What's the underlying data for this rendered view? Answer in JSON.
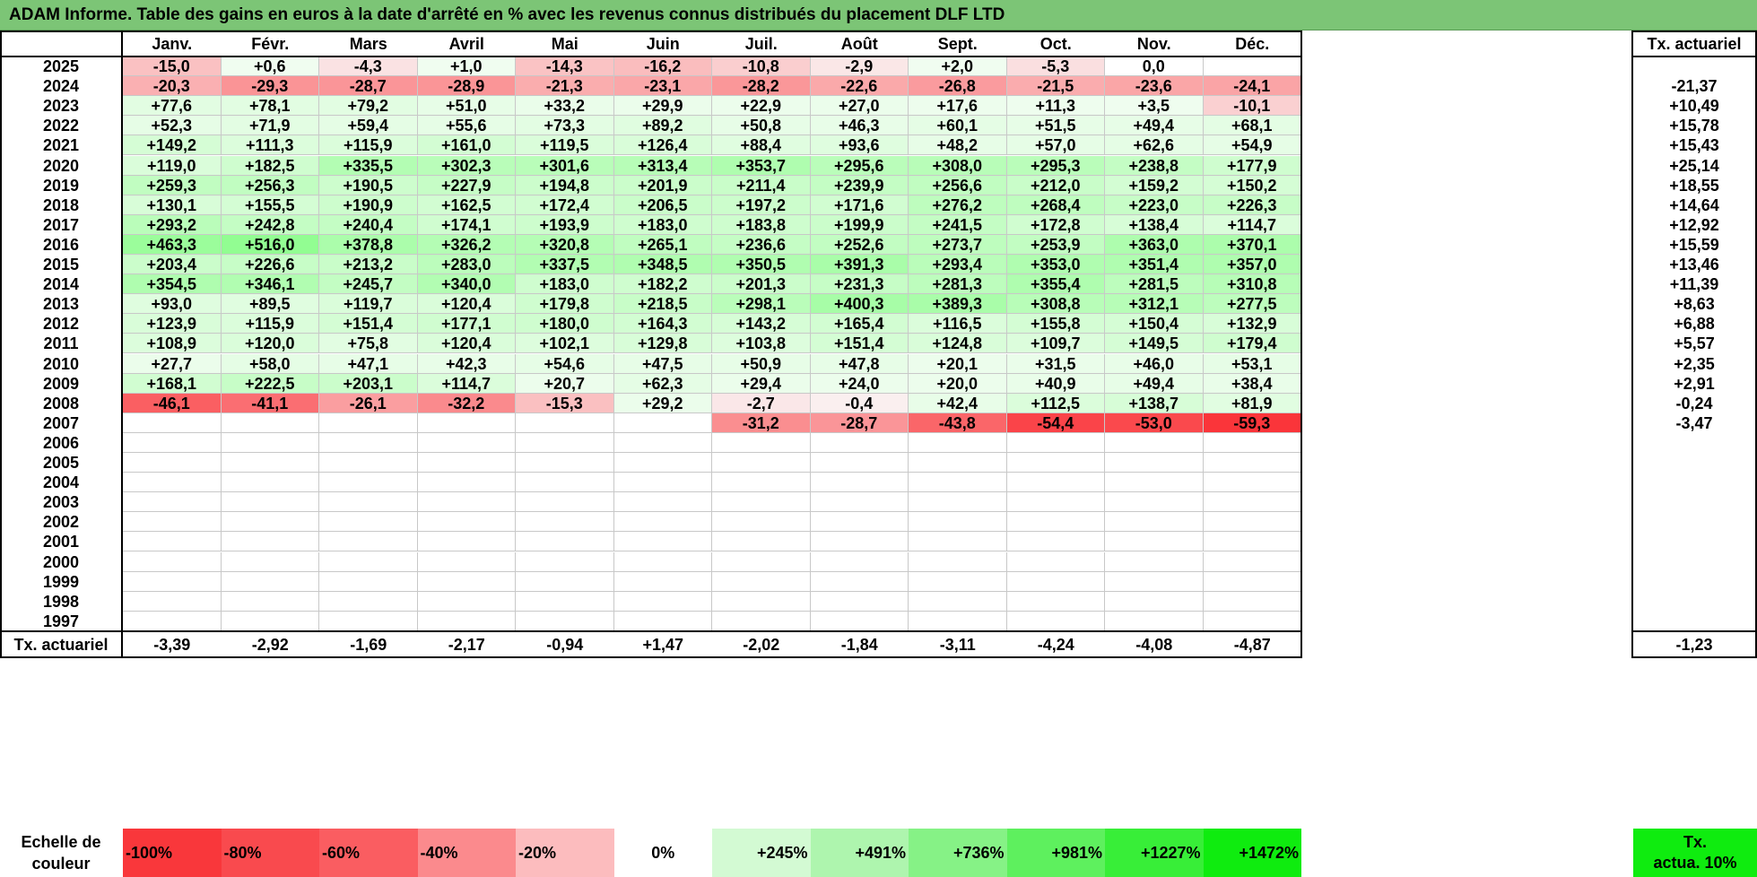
{
  "title": "ADAM Informe. Table des gains en euros à la date d'arrêté en % avec les revenus connus distribués du placement DLF LTD",
  "months": [
    "Janv.",
    "Févr.",
    "Mars",
    "Avril",
    "Mai",
    "Juin",
    "Juil.",
    "Août",
    "Sept.",
    "Oct.",
    "Nov.",
    "Déc."
  ],
  "rate_header": "Tx. actuariel",
  "rows": [
    {
      "year": "2025",
      "values": [
        "-15,0",
        "+0,6",
        "-4,3",
        "+1,0",
        "-14,3",
        "-16,2",
        "-10,8",
        "-2,9",
        "+2,0",
        "-5,3",
        "0,0",
        ""
      ],
      "rate": ""
    },
    {
      "year": "2024",
      "values": [
        "-20,3",
        "-29,3",
        "-28,7",
        "-28,9",
        "-21,3",
        "-23,1",
        "-28,2",
        "-22,6",
        "-26,8",
        "-21,5",
        "-23,6",
        "-24,1"
      ],
      "rate": "-21,37"
    },
    {
      "year": "2023",
      "values": [
        "+77,6",
        "+78,1",
        "+79,2",
        "+51,0",
        "+33,2",
        "+29,9",
        "+22,9",
        "+27,0",
        "+17,6",
        "+11,3",
        "+3,5",
        "-10,1"
      ],
      "rate": "+10,49"
    },
    {
      "year": "2022",
      "values": [
        "+52,3",
        "+71,9",
        "+59,4",
        "+55,6",
        "+73,3",
        "+89,2",
        "+50,8",
        "+46,3",
        "+60,1",
        "+51,5",
        "+49,4",
        "+68,1"
      ],
      "rate": "+15,78"
    },
    {
      "year": "2021",
      "values": [
        "+149,2",
        "+111,3",
        "+115,9",
        "+161,0",
        "+119,5",
        "+126,4",
        "+88,4",
        "+93,6",
        "+48,2",
        "+57,0",
        "+62,6",
        "+54,9"
      ],
      "rate": "+15,43"
    },
    {
      "year": "2020",
      "values": [
        "+119,0",
        "+182,5",
        "+335,5",
        "+302,3",
        "+301,6",
        "+313,4",
        "+353,7",
        "+295,6",
        "+308,0",
        "+295,3",
        "+238,8",
        "+177,9"
      ],
      "rate": "+25,14"
    },
    {
      "year": "2019",
      "values": [
        "+259,3",
        "+256,3",
        "+190,5",
        "+227,9",
        "+194,8",
        "+201,9",
        "+211,4",
        "+239,9",
        "+256,6",
        "+212,0",
        "+159,2",
        "+150,2"
      ],
      "rate": "+18,55"
    },
    {
      "year": "2018",
      "values": [
        "+130,1",
        "+155,5",
        "+190,9",
        "+162,5",
        "+172,4",
        "+206,5",
        "+197,2",
        "+171,6",
        "+276,2",
        "+268,4",
        "+223,0",
        "+226,3"
      ],
      "rate": "+14,64"
    },
    {
      "year": "2017",
      "values": [
        "+293,2",
        "+242,8",
        "+240,4",
        "+174,1",
        "+193,9",
        "+183,0",
        "+183,8",
        "+199,9",
        "+241,5",
        "+172,8",
        "+138,4",
        "+114,7"
      ],
      "rate": "+12,92"
    },
    {
      "year": "2016",
      "values": [
        "+463,3",
        "+516,0",
        "+378,8",
        "+326,2",
        "+320,8",
        "+265,1",
        "+236,6",
        "+252,6",
        "+273,7",
        "+253,9",
        "+363,0",
        "+370,1"
      ],
      "rate": "+15,59"
    },
    {
      "year": "2015",
      "values": [
        "+203,4",
        "+226,6",
        "+213,2",
        "+283,0",
        "+337,5",
        "+348,5",
        "+350,5",
        "+391,3",
        "+293,4",
        "+353,0",
        "+351,4",
        "+357,0"
      ],
      "rate": "+13,46"
    },
    {
      "year": "2014",
      "values": [
        "+354,5",
        "+346,1",
        "+245,7",
        "+340,0",
        "+183,0",
        "+182,2",
        "+201,3",
        "+231,3",
        "+281,3",
        "+355,4",
        "+281,5",
        "+310,8"
      ],
      "rate": "+11,39"
    },
    {
      "year": "2013",
      "values": [
        "+93,0",
        "+89,5",
        "+119,7",
        "+120,4",
        "+179,8",
        "+218,5",
        "+298,1",
        "+400,3",
        "+389,3",
        "+308,8",
        "+312,1",
        "+277,5"
      ],
      "rate": "+8,63"
    },
    {
      "year": "2012",
      "values": [
        "+123,9",
        "+115,9",
        "+151,4",
        "+177,1",
        "+180,0",
        "+164,3",
        "+143,2",
        "+165,4",
        "+116,5",
        "+155,8",
        "+150,4",
        "+132,9"
      ],
      "rate": "+6,88"
    },
    {
      "year": "2011",
      "values": [
        "+108,9",
        "+120,0",
        "+75,8",
        "+120,4",
        "+102,1",
        "+129,8",
        "+103,8",
        "+151,4",
        "+124,8",
        "+109,7",
        "+149,5",
        "+179,4"
      ],
      "rate": "+5,57"
    },
    {
      "year": "2010",
      "values": [
        "+27,7",
        "+58,0",
        "+47,1",
        "+42,3",
        "+54,6",
        "+47,5",
        "+50,9",
        "+47,8",
        "+20,1",
        "+31,5",
        "+46,0",
        "+53,1"
      ],
      "rate": "+2,35"
    },
    {
      "year": "2009",
      "values": [
        "+168,1",
        "+222,5",
        "+203,1",
        "+114,7",
        "+20,7",
        "+62,3",
        "+29,4",
        "+24,0",
        "+20,0",
        "+40,9",
        "+49,4",
        "+38,4"
      ],
      "rate": "+2,91"
    },
    {
      "year": "2008",
      "values": [
        "-46,1",
        "-41,1",
        "-26,1",
        "-32,2",
        "-15,3",
        "+29,2",
        "-2,7",
        "-0,4",
        "+42,4",
        "+112,5",
        "+138,7",
        "+81,9"
      ],
      "rate": "-0,24"
    },
    {
      "year": "2007",
      "values": [
        "",
        "",
        "",
        "",
        "",
        "",
        "-31,2",
        "-28,7",
        "-43,8",
        "-54,4",
        "-53,0",
        "-59,3"
      ],
      "rate": "-3,47"
    },
    {
      "year": "2006",
      "values": [
        "",
        "",
        "",
        "",
        "",
        "",
        "",
        "",
        "",
        "",
        "",
        ""
      ],
      "rate": ""
    },
    {
      "year": "2005",
      "values": [
        "",
        "",
        "",
        "",
        "",
        "",
        "",
        "",
        "",
        "",
        "",
        ""
      ],
      "rate": ""
    },
    {
      "year": "2004",
      "values": [
        "",
        "",
        "",
        "",
        "",
        "",
        "",
        "",
        "",
        "",
        "",
        ""
      ],
      "rate": ""
    },
    {
      "year": "2003",
      "values": [
        "",
        "",
        "",
        "",
        "",
        "",
        "",
        "",
        "",
        "",
        "",
        ""
      ],
      "rate": ""
    },
    {
      "year": "2002",
      "values": [
        "",
        "",
        "",
        "",
        "",
        "",
        "",
        "",
        "",
        "",
        "",
        ""
      ],
      "rate": ""
    },
    {
      "year": "2001",
      "values": [
        "",
        "",
        "",
        "",
        "",
        "",
        "",
        "",
        "",
        "",
        "",
        ""
      ],
      "rate": ""
    },
    {
      "year": "2000",
      "values": [
        "",
        "",
        "",
        "",
        "",
        "",
        "",
        "",
        "",
        "",
        "",
        ""
      ],
      "rate": ""
    },
    {
      "year": "1999",
      "values": [
        "",
        "",
        "",
        "",
        "",
        "",
        "",
        "",
        "",
        "",
        "",
        ""
      ],
      "rate": ""
    },
    {
      "year": "1998",
      "values": [
        "",
        "",
        "",
        "",
        "",
        "",
        "",
        "",
        "",
        "",
        "",
        ""
      ],
      "rate": ""
    },
    {
      "year": "1997",
      "values": [
        "",
        "",
        "",
        "",
        "",
        "",
        "",
        "",
        "",
        "",
        "",
        ""
      ],
      "rate": ""
    }
  ],
  "footer": {
    "label": "Tx. actuariel",
    "values": [
      "-3,39",
      "-2,92",
      "-1,69",
      "-2,17",
      "-0,94",
      "+1,47",
      "-2,02",
      "-1,84",
      "-3,11",
      "-4,24",
      "-4,08",
      "-4,87"
    ],
    "rate": "-1,23"
  },
  "scale": {
    "label_line1": "Echelle de",
    "label_line2": "couleur",
    "steps": [
      "-100%",
      "-80%",
      "-60%",
      "-40%",
      "-20%",
      "0%",
      "+245%",
      "+491%",
      "+736%",
      "+981%",
      "+1227%",
      "+1472%"
    ],
    "colors": [
      "#f9373b",
      "#f94a4e",
      "#fa5d61",
      "#fb8a8d",
      "#fcbcbe",
      "#ffffff",
      "#d3fad3",
      "#aef5ae",
      "#86f286",
      "#5ef05e",
      "#38ee38",
      "#0fec0f"
    ],
    "right_line1": "Tx.",
    "right_line2": "actua. 10%",
    "right_color": "#0fec0f"
  },
  "colors": {
    "title_bg": "#7cc576",
    "negative_max": "#f9373b",
    "positive_max": "#0fec0f"
  }
}
